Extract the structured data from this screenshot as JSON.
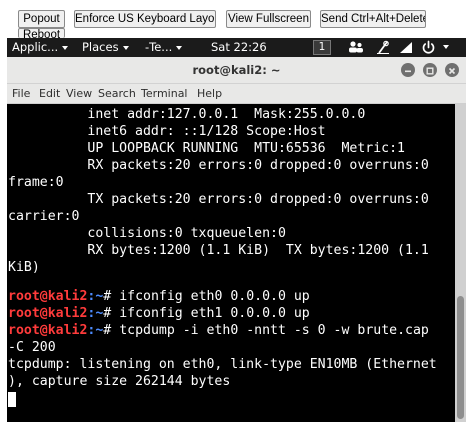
{
  "vnc_toolbar": {
    "popout": "Popout",
    "keyboard": "Enforce US Keyboard Layout",
    "fullscreen": "View Fullscreen",
    "ctrl_alt_del": "Send Ctrl+Alt+Delete",
    "reboot": "Reboot"
  },
  "panel": {
    "applications": "Applic...",
    "places": "Places",
    "terminal": "‑Te...",
    "clock": "Sat 22:26",
    "workspace": "1",
    "icons": [
      "terminal-icon",
      "users-icon",
      "microphone-icon",
      "volume-icon",
      "power-icon"
    ]
  },
  "window": {
    "title": "root@kali2: ~",
    "controls": [
      "minimize-icon",
      "maximize-icon",
      "close-icon"
    ],
    "menu": [
      "File",
      "Edit",
      "View",
      "Search",
      "Terminal",
      "Help"
    ]
  },
  "terminal": {
    "lines": [
      "          inet addr:127.0.0.1  Mask:255.0.0.0",
      "          inet6 addr: ::1/128 Scope:Host",
      "          UP LOOPBACK RUNNING  MTU:65536  Metric:1",
      "          RX packets:20 errors:0 dropped:0 overruns:0",
      "frame:0",
      "          TX packets:20 errors:0 dropped:0 overruns:0",
      "carrier:0",
      "          collisions:0 txqueuelen:0",
      "          RX bytes:1200 (1.1 KiB)  TX bytes:1200 (1.1",
      "KiB)",
      "",
      "",
      "",
      "",
      "-C 200",
      "tcpdump: listening on eth0, link-type EN10MB (Ethernet",
      "), capture size 262144 bytes"
    ],
    "prompt_user": "root@kali2",
    "prompt_path": ":~",
    "prompt_symbol": "# ",
    "commands": [
      "ifconfig eth0 0.0.0.0 up",
      "ifconfig eth1 0.0.0.0 up",
      "tcpdump -i eth0 -nntt -s 0 -w brute.cap"
    ]
  },
  "colors": {
    "prompt_user": "#ff3b3b",
    "prompt_path": "#4d8cff",
    "terminal_bg": "#000000",
    "panel_bg": "#1b1b1b"
  }
}
